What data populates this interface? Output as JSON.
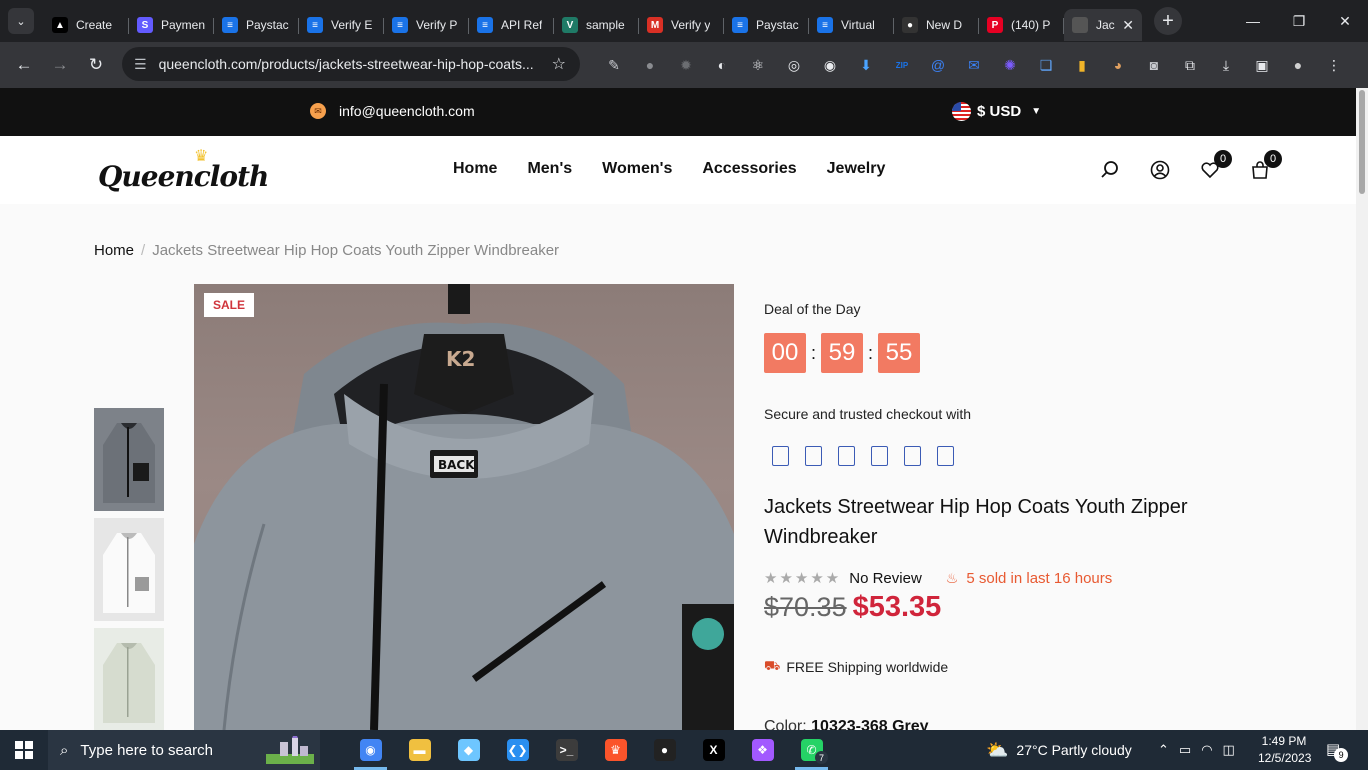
{
  "browser": {
    "tabs": [
      {
        "title": "Create",
        "icon": "triangle-icon",
        "color": "#000000",
        "glyph": "▲"
      },
      {
        "title": "Paymen",
        "icon": "stripe-icon",
        "color": "#635bff",
        "glyph": "S"
      },
      {
        "title": "Paystac",
        "icon": "doc-icon",
        "color": "#1a73e8",
        "glyph": "≡"
      },
      {
        "title": "Verify E",
        "icon": "doc-icon",
        "color": "#1a73e8",
        "glyph": "≡"
      },
      {
        "title": "Verify P",
        "icon": "doc-icon",
        "color": "#1a73e8",
        "glyph": "≡"
      },
      {
        "title": "API Ref",
        "icon": "doc-icon",
        "color": "#1a73e8",
        "glyph": "≡"
      },
      {
        "title": "sample",
        "icon": "vue-icon",
        "color": "#1f7a66",
        "glyph": "V"
      },
      {
        "title": "Verify y",
        "icon": "gmail-icon",
        "color": "#d93025",
        "glyph": "M"
      },
      {
        "title": "Paystac",
        "icon": "doc-icon",
        "color": "#1a73e8",
        "glyph": "≡"
      },
      {
        "title": "Virtual",
        "icon": "doc-icon",
        "color": "#1a73e8",
        "glyph": "≡"
      },
      {
        "title": "New D",
        "icon": "person-icon",
        "color": "#333333",
        "glyph": "●"
      },
      {
        "title": "(140) P",
        "icon": "pinterest-icon",
        "color": "#e60023",
        "glyph": "P"
      }
    ],
    "active_tab": {
      "title": "Jac",
      "close": "✕"
    },
    "new_tab": "+",
    "window_controls": {
      "minimize": "—",
      "maximize": "❐",
      "close": "✕"
    },
    "url": "queencloth.com/products/jackets-streetwear-hip-hop-coats...",
    "extensions": [
      {
        "name": "eyedropper-icon",
        "glyph": "✎",
        "color": "#c8cacf"
      },
      {
        "name": "ext-dot-icon",
        "glyph": "●",
        "color": "#8a8c90"
      },
      {
        "name": "bug-icon",
        "glyph": "✹",
        "color": "#6b6d71"
      },
      {
        "name": "swirl-icon",
        "glyph": "◐",
        "color": "#e8eaed"
      },
      {
        "name": "react-icon",
        "glyph": "⚛",
        "color": "#e8eaed"
      },
      {
        "name": "target-icon",
        "glyph": "◎",
        "color": "#e8eaed"
      },
      {
        "name": "circle-ext-icon",
        "glyph": "◉",
        "color": "#e8eaed"
      },
      {
        "name": "download-ext-icon",
        "glyph": "⬇",
        "color": "#4aa3ff"
      },
      {
        "name": "zip-icon",
        "glyph": "ZIP",
        "color": "#1a73e8"
      },
      {
        "name": "at-icon",
        "glyph": "@",
        "color": "#3b82f6"
      },
      {
        "name": "mail-ext-icon",
        "glyph": "✉",
        "color": "#3b82f6"
      },
      {
        "name": "gear-purple-icon",
        "glyph": "✺",
        "color": "#7c5cff"
      },
      {
        "name": "files-icon",
        "glyph": "❏",
        "color": "#60a5fa"
      },
      {
        "name": "chart-ext-icon",
        "glyph": "▮",
        "color": "#f0b429"
      },
      {
        "name": "owl-icon",
        "glyph": "◕",
        "color": "#e0a060"
      },
      {
        "name": "camera-icon",
        "glyph": "◙",
        "color": "#c8cacf"
      },
      {
        "name": "puzzle-icon",
        "glyph": "⧉",
        "color": "#e8eaed"
      },
      {
        "name": "downloads-icon",
        "glyph": "⤓",
        "color": "#e8eaed"
      },
      {
        "name": "sidepanel-icon",
        "glyph": "▣",
        "color": "#e8eaed"
      },
      {
        "name": "profile-icon",
        "glyph": "●",
        "color": "#d0d0d0"
      },
      {
        "name": "kebab-menu-icon",
        "glyph": "⋮",
        "color": "#e8eaed"
      }
    ]
  },
  "site": {
    "email": "info@queencloth.com",
    "currency": "$ USD",
    "logo": "Queencloth",
    "nav": [
      "Home",
      "Men's",
      "Women's",
      "Accessories",
      "Jewelry"
    ],
    "wishlist_count": "0",
    "cart_count": "0"
  },
  "breadcrumb": {
    "home": "Home",
    "sep": "/",
    "current": "Jackets Streetwear Hip Hop Coats Youth Zipper Windbreaker"
  },
  "product": {
    "sale_badge": "SALE",
    "deal_label": "Deal of the Day",
    "countdown": {
      "hours": "00",
      "minutes": "59",
      "seconds": "55",
      "sep": ":"
    },
    "secure_label": "Secure and trusted checkout with",
    "title": "Jackets Streetwear Hip Hop Coats Youth Zipper Windbreaker",
    "rating": 0,
    "stars": "★★★★★",
    "review_text": "No Review",
    "sold_text": "5 sold in last 16 hours",
    "old_price": "$70.35",
    "new_price": "$53.35",
    "shipping": "FREE Shipping worldwide",
    "color_label": "Color:",
    "color_value": "10323-368 Grey",
    "jacket_labels": {
      "hanger": "K2",
      "patch": "BACK"
    }
  },
  "taskbar": {
    "search_placeholder": "Type here to search",
    "apps": [
      {
        "name": "chrome-icon",
        "glyph": "◉",
        "color": "#4285f4",
        "active": true,
        "badge": ""
      },
      {
        "name": "file-explorer-icon",
        "glyph": "▬",
        "color": "#f0c040",
        "active": false,
        "badge": ""
      },
      {
        "name": "sticky-app-icon",
        "glyph": "◆",
        "color": "#6ec6ff",
        "active": false,
        "badge": ""
      },
      {
        "name": "vscode-icon",
        "glyph": "❮❯",
        "color": "#2a8ff0",
        "active": false,
        "badge": ""
      },
      {
        "name": "terminal-icon",
        "glyph": ">_",
        "color": "#3c3c3c",
        "active": false,
        "badge": ""
      },
      {
        "name": "brave-icon",
        "glyph": "♛",
        "color": "#fb542b",
        "active": false,
        "badge": ""
      },
      {
        "name": "record-icon",
        "glyph": "●",
        "color": "#222222",
        "active": false,
        "badge": ""
      },
      {
        "name": "x-app-icon",
        "glyph": "X",
        "color": "#000000",
        "active": false,
        "badge": ""
      },
      {
        "name": "figma-icon",
        "glyph": "❖",
        "color": "#a259ff",
        "active": false,
        "badge": ""
      },
      {
        "name": "whatsapp-icon",
        "glyph": "✆",
        "color": "#25d366",
        "active": true,
        "badge": "7"
      }
    ],
    "weather": "27°C  Partly cloudy",
    "time": "1:49 PM",
    "date": "12/5/2023",
    "notifications": "9"
  }
}
